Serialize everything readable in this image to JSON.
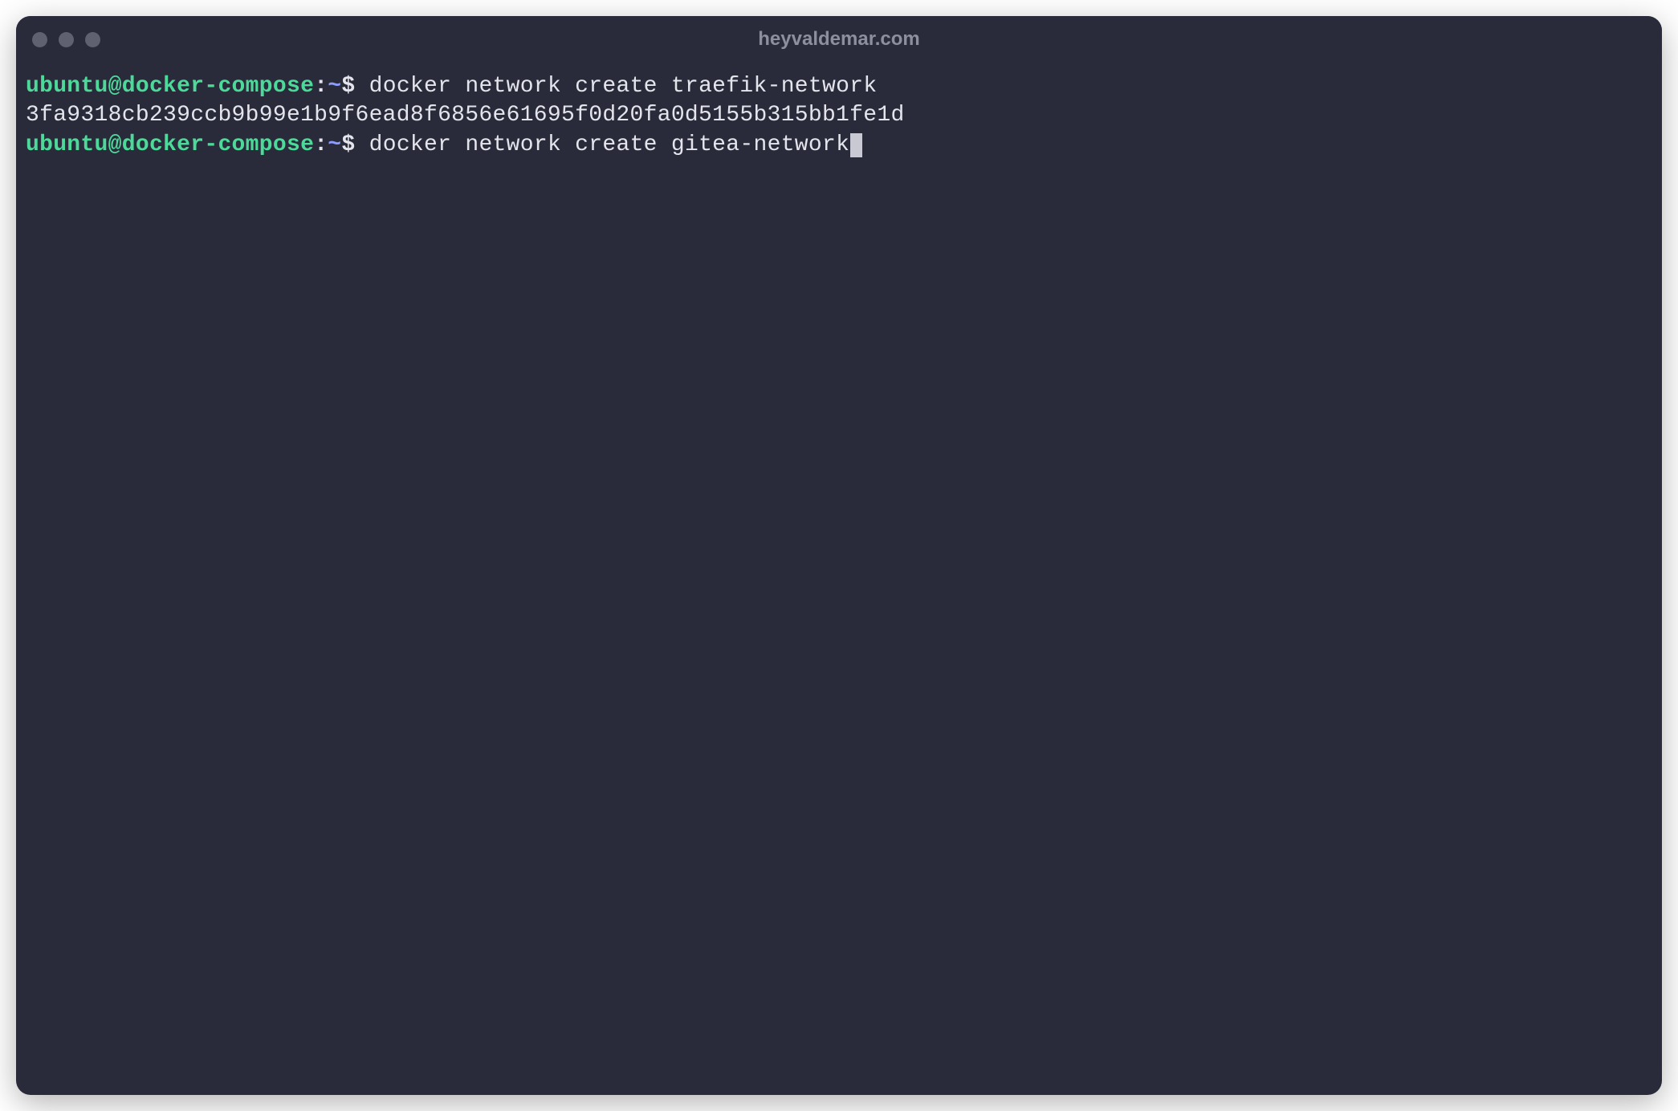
{
  "window": {
    "title": "heyvaldemar.com"
  },
  "prompt": {
    "user": "ubuntu",
    "at": "@",
    "host": "docker-compose",
    "colon": ":",
    "path": "~",
    "symbol": "$"
  },
  "lines": {
    "cmd1": " docker network create traefik-network",
    "out1": "3fa9318cb239ccb9b99e1b9f6ead8f6856e61695f0d20fa0d5155b315bb1fe1d",
    "cmd2": " docker network create gitea-network"
  },
  "colors": {
    "background": "#2a2b3a",
    "text": "#e4e5ec",
    "prompt_user": "#4dd99a",
    "prompt_path": "#8d9cff",
    "title_text": "#8d8f9e",
    "traffic_light": "#5f6070",
    "cursor": "#c8c9d2"
  }
}
